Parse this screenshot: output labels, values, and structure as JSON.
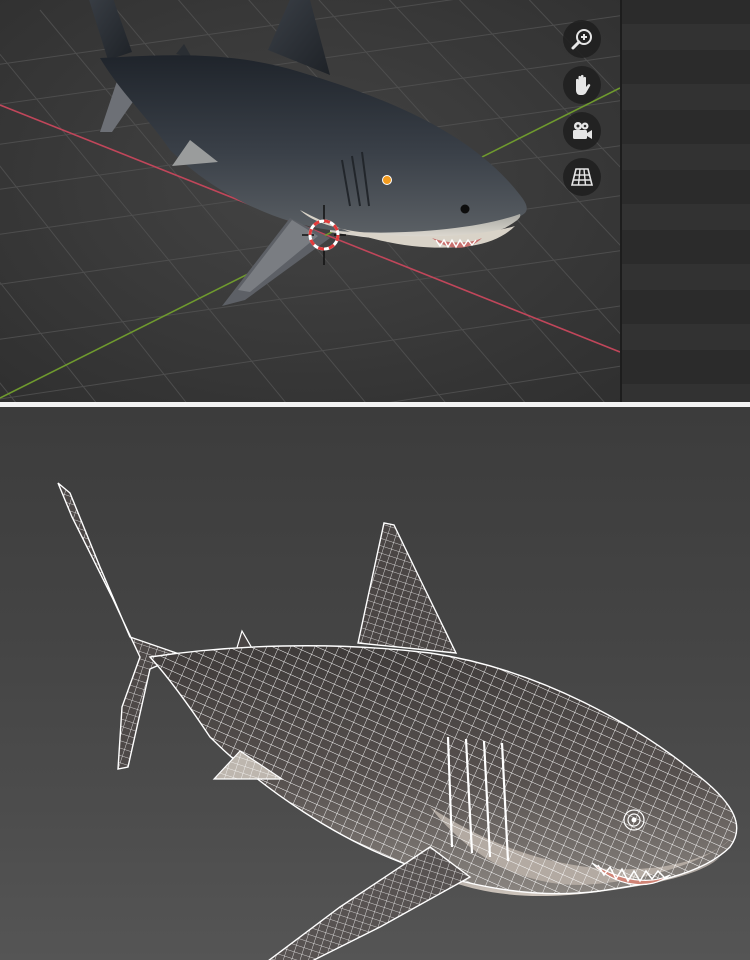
{
  "viewport": {
    "background": "#3d3d3d",
    "x_axis_color": "#c0465a",
    "y_axis_color": "#6f9a2e",
    "cursor_color": "#e23b3b",
    "origin_color": "#f29b1f"
  },
  "navigation_gizmo": [
    {
      "name": "zoom-icon"
    },
    {
      "name": "hand-pan-icon"
    },
    {
      "name": "camera-icon"
    },
    {
      "name": "perspective-grid-icon"
    }
  ],
  "render": {
    "wire_color": "#ffffff",
    "mesh_color": "#5a5553"
  }
}
